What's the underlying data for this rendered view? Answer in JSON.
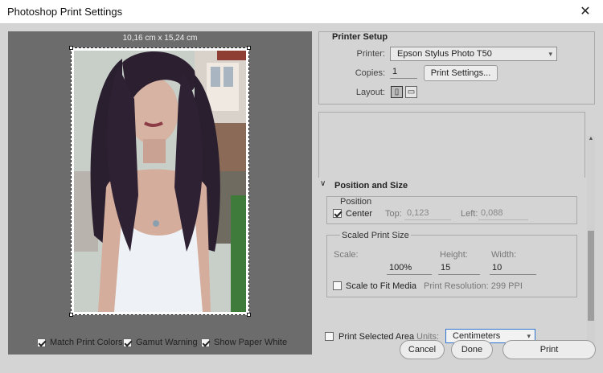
{
  "window": {
    "title": "Photoshop Print Settings",
    "close_glyph": "✕"
  },
  "preview": {
    "dimensions": "10,16 cm x 15,24 cm"
  },
  "bottom_checks": [
    {
      "label": "Match Print Colors",
      "checked": true
    },
    {
      "label": "Gamut Warning",
      "checked": true
    },
    {
      "label": "Show Paper White",
      "checked": true
    }
  ],
  "printer_setup": {
    "title": "Printer Setup",
    "printer_label": "Printer:",
    "printer_value": "Epson Stylus Photo T50",
    "copies_label": "Copies:",
    "copies_value": "1",
    "print_settings_button": "Print Settings...",
    "layout_label": "Layout:"
  },
  "position_size": {
    "title": "Position and Size",
    "position_title": "Position",
    "center_label": "Center",
    "center_checked": true,
    "top_label": "Top:",
    "top_value": "0,123",
    "left_label": "Left:",
    "left_value": "0,088",
    "scaled_title": "Scaled Print Size",
    "scale_label": "Scale:",
    "scale_value": "100%",
    "height_label": "Height:",
    "height_value": "15",
    "width_label": "Width:",
    "width_value": "10",
    "scale_fit_label": "Scale to Fit Media",
    "scale_fit_checked": false,
    "resolution": "Print Resolution: 299 PPI",
    "print_selected_label": "Print Selected Area",
    "print_selected_checked": false,
    "units_label": "Units:",
    "units_value": "Centimeters"
  },
  "buttons": {
    "cancel": "Cancel",
    "done": "Done",
    "print": "Print"
  },
  "icons": {
    "close": "close-icon",
    "dropdown": "chevron-down-icon",
    "collapse": "chevron-down-icon"
  }
}
